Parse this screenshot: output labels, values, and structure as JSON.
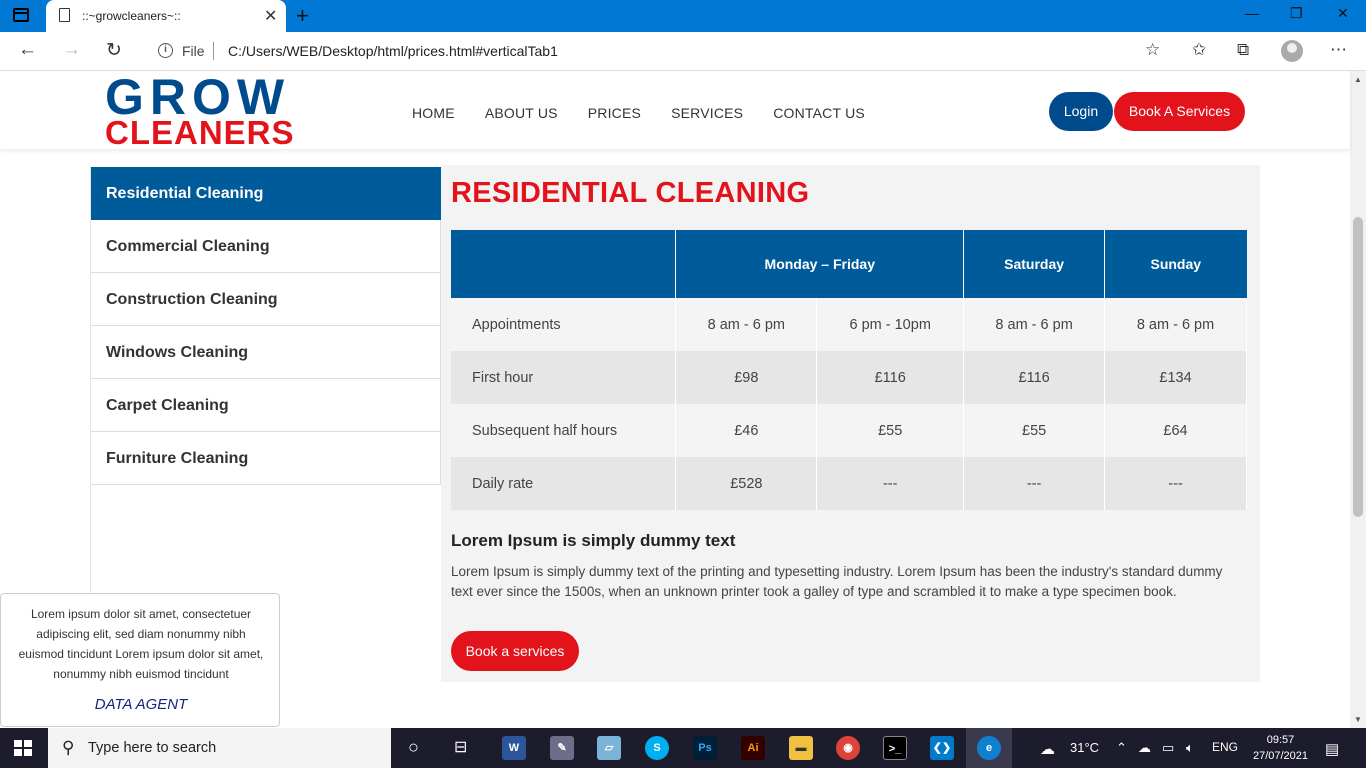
{
  "browser": {
    "tab_title": "::~growcleaners~::",
    "file_label": "File",
    "url": "C:/Users/WEB/Desktop/html/prices.html#verticalTab1"
  },
  "site": {
    "logo_top": "GROW",
    "logo_bottom": "CLEANERS",
    "menu": [
      "HOME",
      "ABOUT US",
      "PRICES",
      "SERVICES",
      "CONTACT US"
    ],
    "login_label": "Login",
    "book_top_label": "Book A Services",
    "brand_colors": {
      "blue": "#004b8d",
      "red": "#e3131b"
    }
  },
  "sidebar": {
    "items": [
      {
        "label": "Residential Cleaning",
        "active": true
      },
      {
        "label": "Commercial Cleaning",
        "active": false
      },
      {
        "label": "Construction Cleaning",
        "active": false
      },
      {
        "label": "Windows Cleaning",
        "active": false
      },
      {
        "label": "Carpet Cleaning",
        "active": false
      },
      {
        "label": "Furniture Cleaning",
        "active": false
      }
    ]
  },
  "panel": {
    "title": "RESIDENTIAL CLEANING",
    "table": {
      "headers": [
        "",
        "Monday – Friday",
        "Saturday",
        "Sunday"
      ],
      "rows": [
        [
          "Appointments",
          "8 am - 6 pm",
          "6 pm - 10pm",
          "8 am - 6 pm",
          "8 am - 6 pm"
        ],
        [
          "First hour",
          "£98",
          "£116",
          "£116",
          "£134"
        ],
        [
          "Subsequent half hours",
          "£46",
          "£55",
          "£55",
          "£64"
        ],
        [
          "Daily rate",
          "£528",
          "---",
          "---",
          "---"
        ]
      ]
    },
    "lorem_heading": "Lorem Ipsum is simply dummy text",
    "lorem_body": "Lorem Ipsum is simply dummy text of the printing and typesetting industry. Lorem Ipsum has been the industry's standard dummy text ever since the 1500s, when an unknown printer took a galley of type and scrambled it to make a type specimen book.",
    "book_label": "Book a services"
  },
  "agent": {
    "text": "Lorem ipsum dolor sit amet, consectetuer adipiscing elit, sed diam nonummy nibh euismod tincidunt Lorem ipsum dolor sit amet, nonummy nibh euismod tincidunt",
    "name": "DATA AGENT"
  },
  "taskbar": {
    "search_placeholder": "Type here to search",
    "weather": "31°C",
    "language": "ENG",
    "time": "09:57",
    "date": "27/07/2021"
  }
}
